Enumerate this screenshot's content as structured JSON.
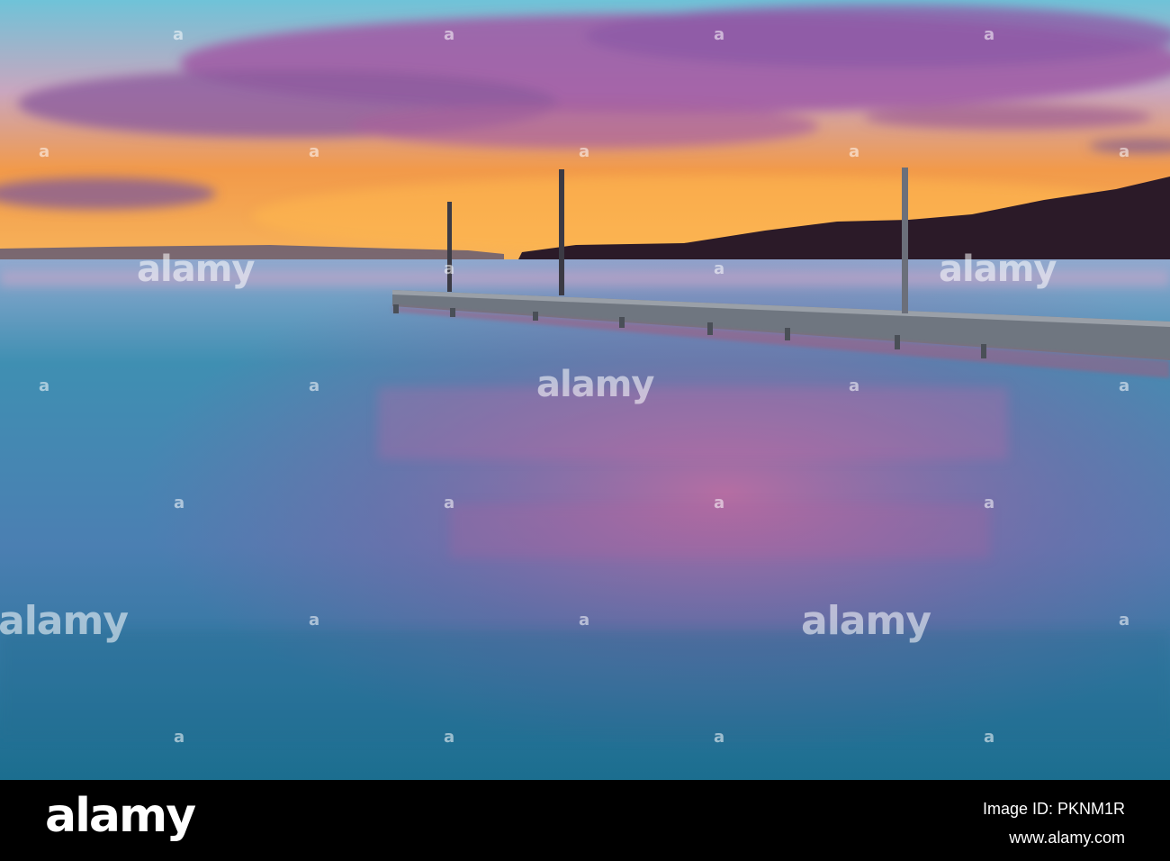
{
  "watermark": {
    "brand": "alamy",
    "mark_glyph": "a"
  },
  "footer": {
    "logo": "alamy",
    "image_id": "Image ID: PKNM1R",
    "url": "www.alamy.com"
  },
  "colors": {
    "sky_top": "#7fc6d9",
    "sky_horizon": "#f7a73a",
    "cloud": "#a95ea6",
    "water_light": "#5fb3c9",
    "water_pink": "#b35a9c",
    "water_dark": "#1f6d8f",
    "hill": "#2a1a26",
    "pier": "#8a8f96"
  }
}
